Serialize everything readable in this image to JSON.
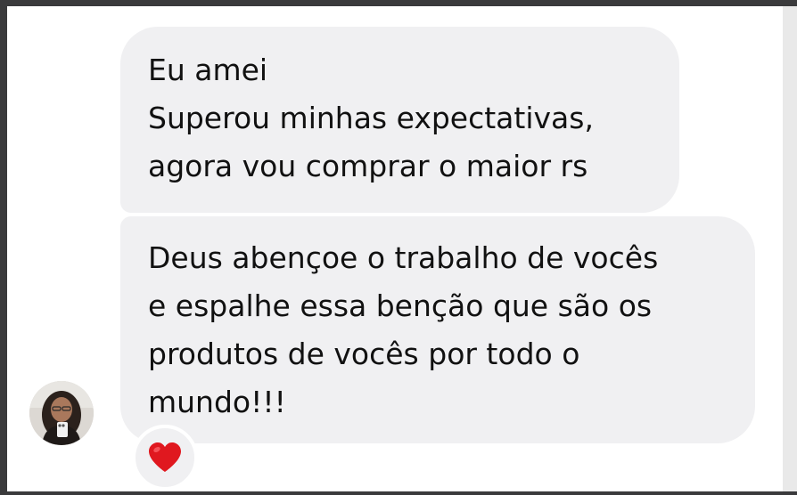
{
  "conversation": {
    "messages": [
      {
        "lines": [
          "Eu amei",
          "Superou minhas expectativas,",
          "agora vou comprar o maior rs"
        ]
      },
      {
        "lines": [
          "Deus abençoe o trabalho de vocês",
          "e espalhe essa benção que são os",
          "produtos de vocês por todo o",
          "mundo!!!"
        ]
      }
    ],
    "reaction": {
      "icon": "heart-icon",
      "color": "#e0181f"
    },
    "sender": {
      "avatar_icon": "avatar"
    }
  },
  "colors": {
    "bubble_background": "#f0f0f2",
    "text": "#111111",
    "page_background": "#ffffff",
    "border": "#3a3a3c"
  }
}
